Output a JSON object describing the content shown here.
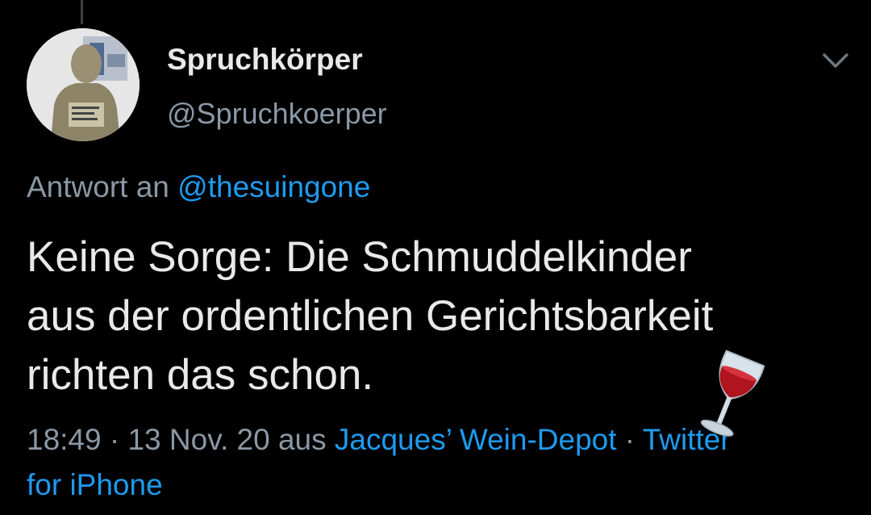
{
  "tweet": {
    "author": {
      "display_name": "Spruchkörper",
      "handle": "@Spruchkoerper"
    },
    "reply_prefix": "Antwort an",
    "reply_mention": "@thesuingone",
    "text_lines": [
      "Keine Sorge: Die Schmuddelkinder",
      "aus der ordentlichen Gerichtsbarkeit",
      "richten das schon."
    ],
    "time": "18:49",
    "separator": " · ",
    "date": "13 Nov. 20",
    "via_label": " aus ",
    "source_part1": "Jacques’ Wein-Depot",
    "source_part2": "Twitter",
    "source_part3": "for iPhone"
  },
  "icons": {
    "menu": "chevron-down-icon",
    "emoji": "wine-glass-icon"
  },
  "colors": {
    "background": "#000000",
    "text": "#e9e9e9",
    "secondary": "#8b98a5",
    "link": "#1d9bf0"
  }
}
